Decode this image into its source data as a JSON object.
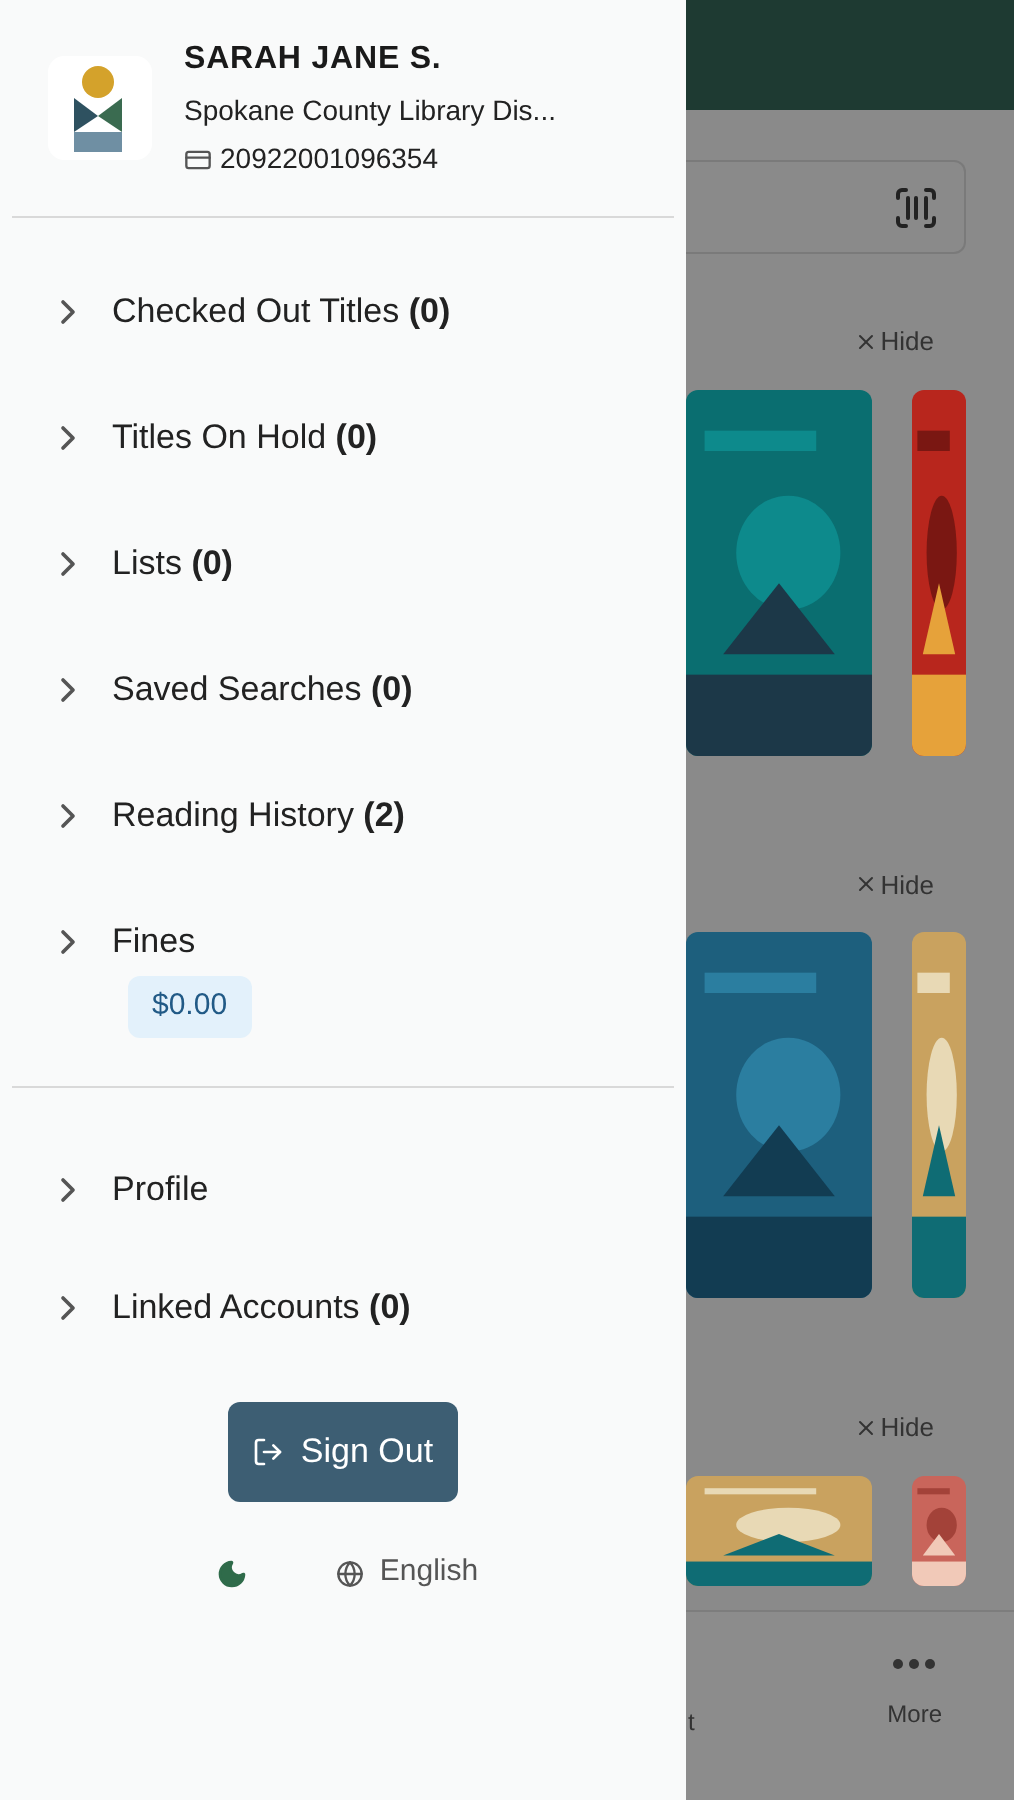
{
  "account": {
    "name": "SARAH JANE S.",
    "library": "Spokane County Library Dis...",
    "card_number": "20922001096354"
  },
  "menu": [
    {
      "label": "Checked Out Titles **(0)**",
      "expanded": false
    },
    {
      "label": "Titles On Hold **(0)**",
      "expanded": false
    },
    {
      "label": "Lists **(0)**",
      "expanded": false
    },
    {
      "label": "Saved Searches **(0)**",
      "expanded": false
    },
    {
      "label": "Reading History **(2)**",
      "expanded": false
    },
    {
      "label": "Fines",
      "expanded": false,
      "badge": "$0.00"
    }
  ],
  "menu_secondary": [
    {
      "label": "Profile",
      "expanded": false
    },
    {
      "label": "Linked Accounts **(0)**",
      "expanded": false
    }
  ],
  "sign_out": "Sign Out",
  "language": "English",
  "background": {
    "sections": [
      {
        "hide": "Hide"
      },
      {
        "hide": "Hide"
      },
      {
        "hide": "Hide"
      }
    ],
    "bottom_nav": [
      {
        "label": "t"
      },
      {
        "label": "More"
      }
    ]
  }
}
